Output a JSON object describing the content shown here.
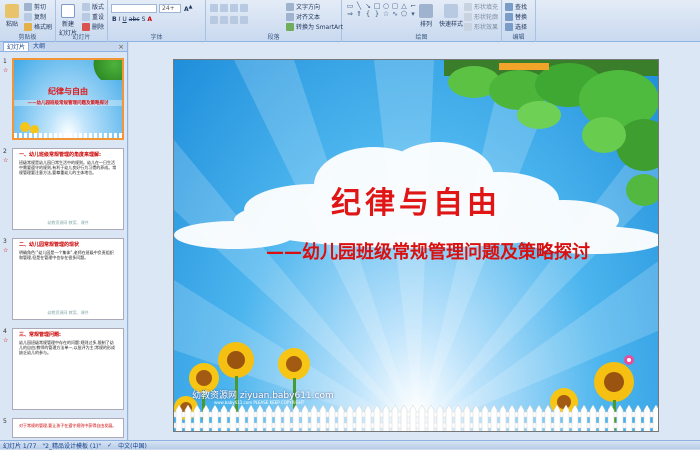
{
  "ribbon": {
    "clipboard": {
      "label": "剪贴板",
      "paste": "粘贴",
      "cut": "剪切",
      "copy": "复制",
      "format_painter": "格式刷"
    },
    "slides": {
      "label": "幻灯片",
      "new_slide": "新建\n幻灯片",
      "layout": "版式",
      "reset": "重设",
      "delete": "删除"
    },
    "font": {
      "label": "字体",
      "size_value": "24+",
      "font_value": ""
    },
    "paragraph": {
      "label": "段落",
      "text_direction": "文字方向",
      "align_text": "对齐文本",
      "smartart": "转换为 SmartArt"
    },
    "drawing": {
      "label": "绘图",
      "arrange": "排列",
      "quick_styles": "快速样式",
      "shape_fill": "形状填充",
      "shape_outline": "形状轮廓",
      "shape_effects": "形状效果"
    },
    "editing": {
      "label": "编辑",
      "find": "查找",
      "replace": "替换",
      "select": "选择"
    }
  },
  "panel": {
    "tab_slides": "幻灯片",
    "tab_outline": "大纲",
    "close": "×",
    "thumbs": [
      {
        "num": "1",
        "title": "纪律与自由",
        "subtitle": "——幼儿园班级常规管理问题及策略探讨",
        "lines": "",
        "footer": ""
      },
      {
        "num": "2",
        "title": "一、幼儿班级常规管理的角度来理解:",
        "subtitle": "",
        "lines": "班级常规是幼儿园日常生活中的规则。幼儿在一日生活中需要遵守的规则,有利于幼儿良好行为习惯的养成。常规管理要注意方法,要尊重幼儿的主体地位。",
        "footer": "幼教资源网 教案、课件"
      },
      {
        "num": "3",
        "title": "二、幼儿园常规管理的现状",
        "subtitle": "",
        "lines": "明确角色:“幼儿园是一个集体”,老师在班级中负责组织和管理,但是在管理中也存在很多问题。",
        "footer": "幼教资源网 教案、课件"
      },
      {
        "num": "4",
        "title": "三、常规管理问题:",
        "subtitle": "",
        "lines": "幼儿园班级常规管理中存在的问题:规则过多,限制了幼儿的自由;教师的管理方法单一,以批评为主;常规的形成缺乏幼儿的参与。",
        "footer": ""
      },
      {
        "num": "5",
        "title": "",
        "subtitle": "",
        "lines": "对于常规的管理,要让孩子在遵守规则中获得自由发展。",
        "footer": ""
      }
    ]
  },
  "slide": {
    "title": "纪律与自由",
    "subtitle": "——幼儿园班级常规管理问题及策略探讨",
    "watermark": "幼教资源网 ziyuan.baby611.com",
    "watermark_small": "www.baby611.com  PLEASE KEEP COPYRIGHT"
  },
  "status": {
    "slide_pos": "幻灯片 1/77",
    "theme": "\"2_精品设计模板 (1)\"",
    "language": "中文(中国)"
  },
  "colors": {
    "title": "#e01616",
    "selected_border": "#f29536"
  }
}
